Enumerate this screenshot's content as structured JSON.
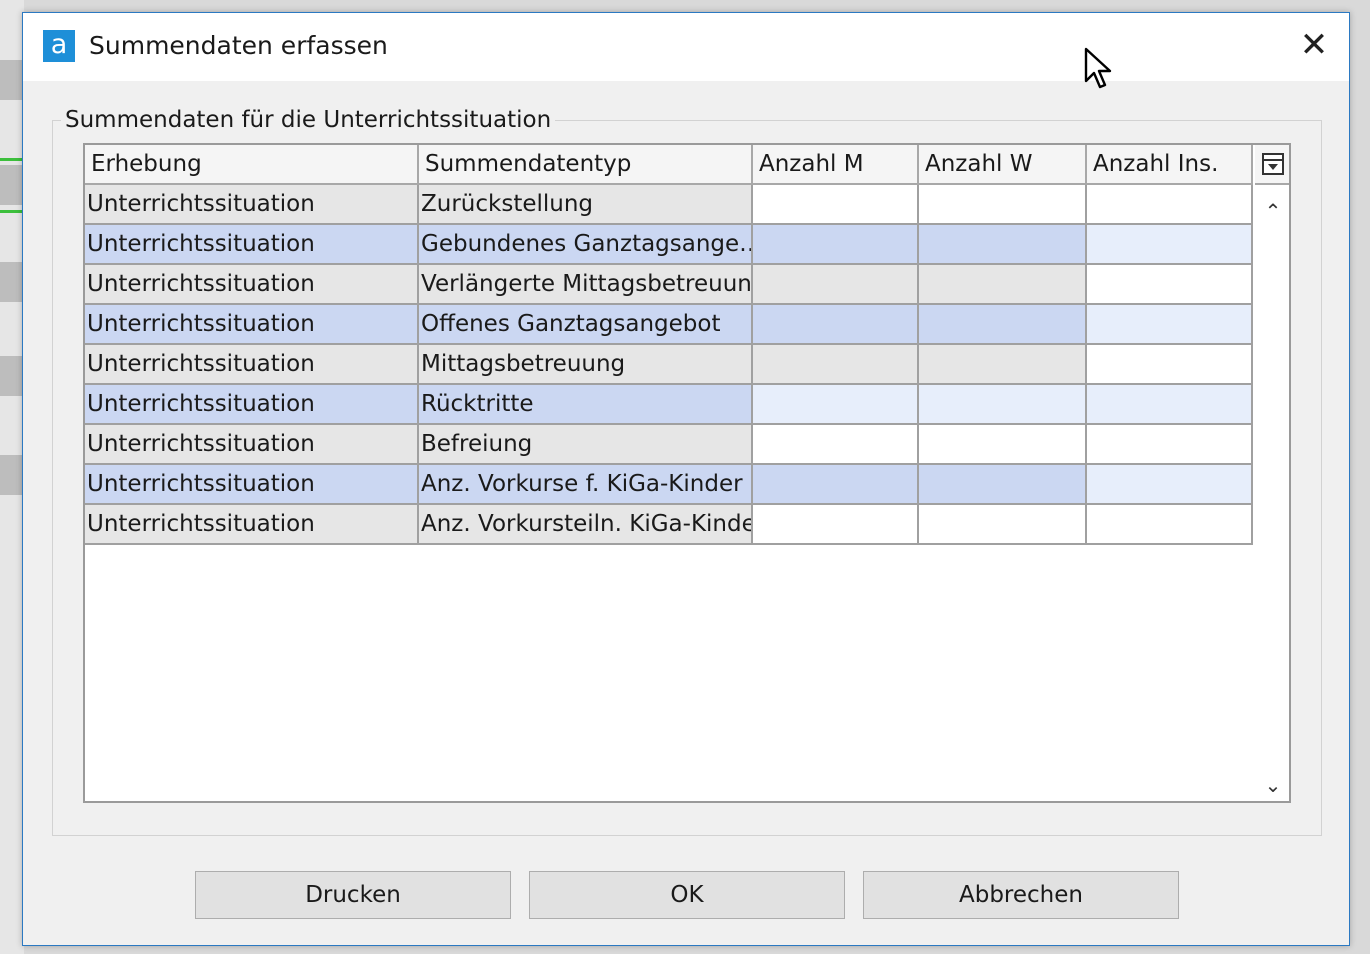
{
  "dialog": {
    "title": "Summendaten erfassen",
    "logo_letter": "a",
    "group_label": "Summendaten für die Unterrichtssituation"
  },
  "table": {
    "columns": [
      "Erhebung",
      "Summendatentyp",
      "Anzahl M",
      "Anzahl W",
      "Anzahl Ins."
    ],
    "rows": [
      {
        "erhebung": "Unterrichtssituation",
        "typ": "Zurückstellung",
        "m": "",
        "w": "",
        "ins": ""
      },
      {
        "erhebung": "Unterrichtssituation",
        "typ": "Gebundenes Ganztagsange…",
        "m": "",
        "w": "",
        "ins": ""
      },
      {
        "erhebung": "Unterrichtssituation",
        "typ": "Verlängerte Mittagsbetreuung",
        "m": "",
        "w": "",
        "ins": ""
      },
      {
        "erhebung": "Unterrichtssituation",
        "typ": "Offenes Ganztagsangebot",
        "m": "",
        "w": "",
        "ins": ""
      },
      {
        "erhebung": "Unterrichtssituation",
        "typ": "Mittagsbetreuung",
        "m": "",
        "w": "",
        "ins": ""
      },
      {
        "erhebung": "Unterrichtssituation",
        "typ": "Rücktritte",
        "m": "",
        "w": "",
        "ins": ""
      },
      {
        "erhebung": "Unterrichtssituation",
        "typ": "Befreiung",
        "m": "",
        "w": "",
        "ins": ""
      },
      {
        "erhebung": "Unterrichtssituation",
        "typ": "Anz. Vorkurse f. KiGa-Kinder",
        "m": "",
        "w": "",
        "ins": ""
      },
      {
        "erhebung": "Unterrichtssituation",
        "typ": "Anz. Vorkursteiln. KiGa-Kinder",
        "m": "",
        "w": "",
        "ins": ""
      }
    ],
    "readonly_m_w_rows": [
      1,
      2,
      3,
      4,
      7
    ]
  },
  "buttons": {
    "print": "Drucken",
    "ok": "OK",
    "cancel": "Abbrechen"
  },
  "icons": {
    "close": "close-icon",
    "column_chooser": "column-chooser-icon",
    "scroll_up": "chevron-up-icon",
    "scroll_down": "chevron-down-icon"
  },
  "colors": {
    "logo": "#1e8fd8",
    "dialog_border": "#2b79c2",
    "row_alt_readonly": "#cbd7f2",
    "row_alt_editable": "#e7eefb",
    "row_readonly": "#e6e6e6",
    "row_editable": "#ffffff"
  }
}
